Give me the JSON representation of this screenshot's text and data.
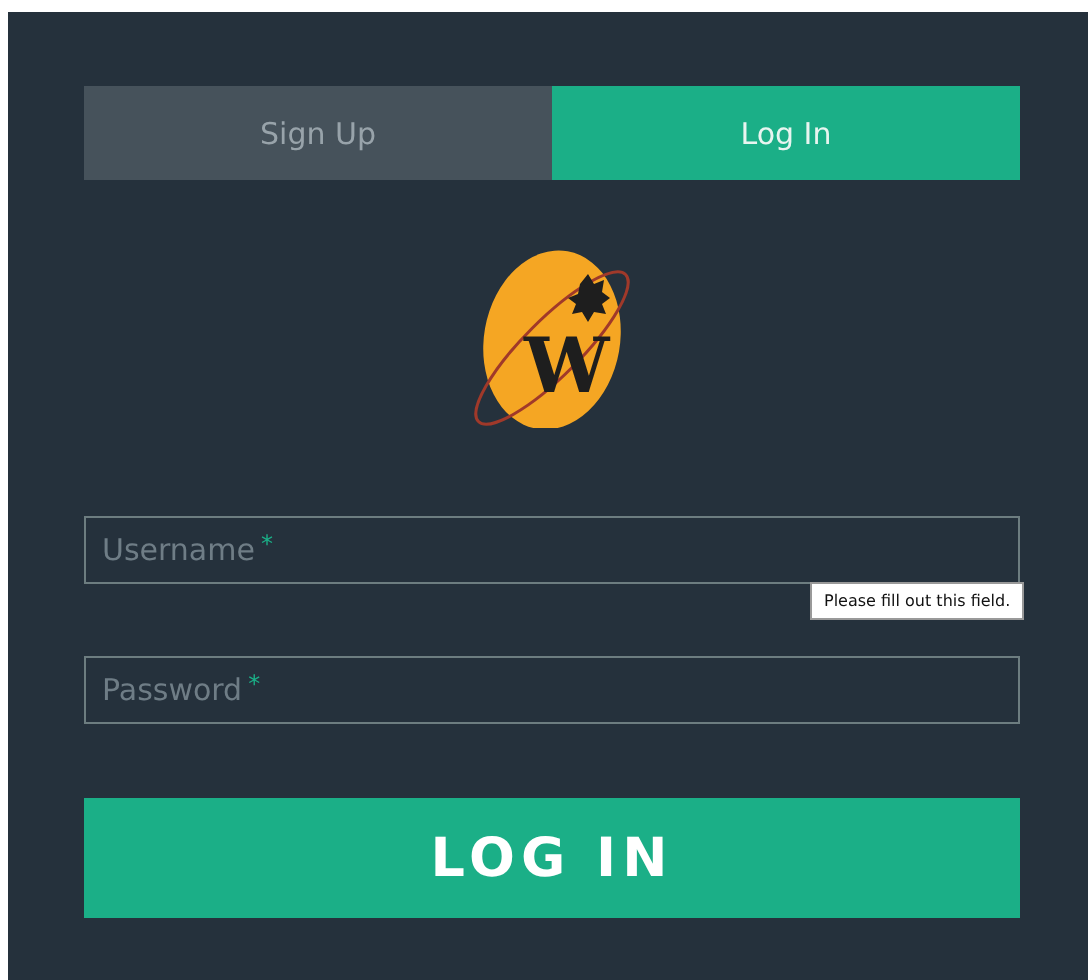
{
  "tabs": [
    {
      "label": "Sign Up",
      "selected": false
    },
    {
      "label": "Log In",
      "selected": true
    }
  ],
  "logo": {
    "text": "W"
  },
  "fields": [
    {
      "placeholder": "Username",
      "required_mark": "*"
    },
    {
      "placeholder": "Password",
      "required_mark": "*"
    }
  ],
  "tooltip": {
    "text": "Please fill out this field."
  },
  "submit_button": {
    "label": "LOG IN"
  }
}
